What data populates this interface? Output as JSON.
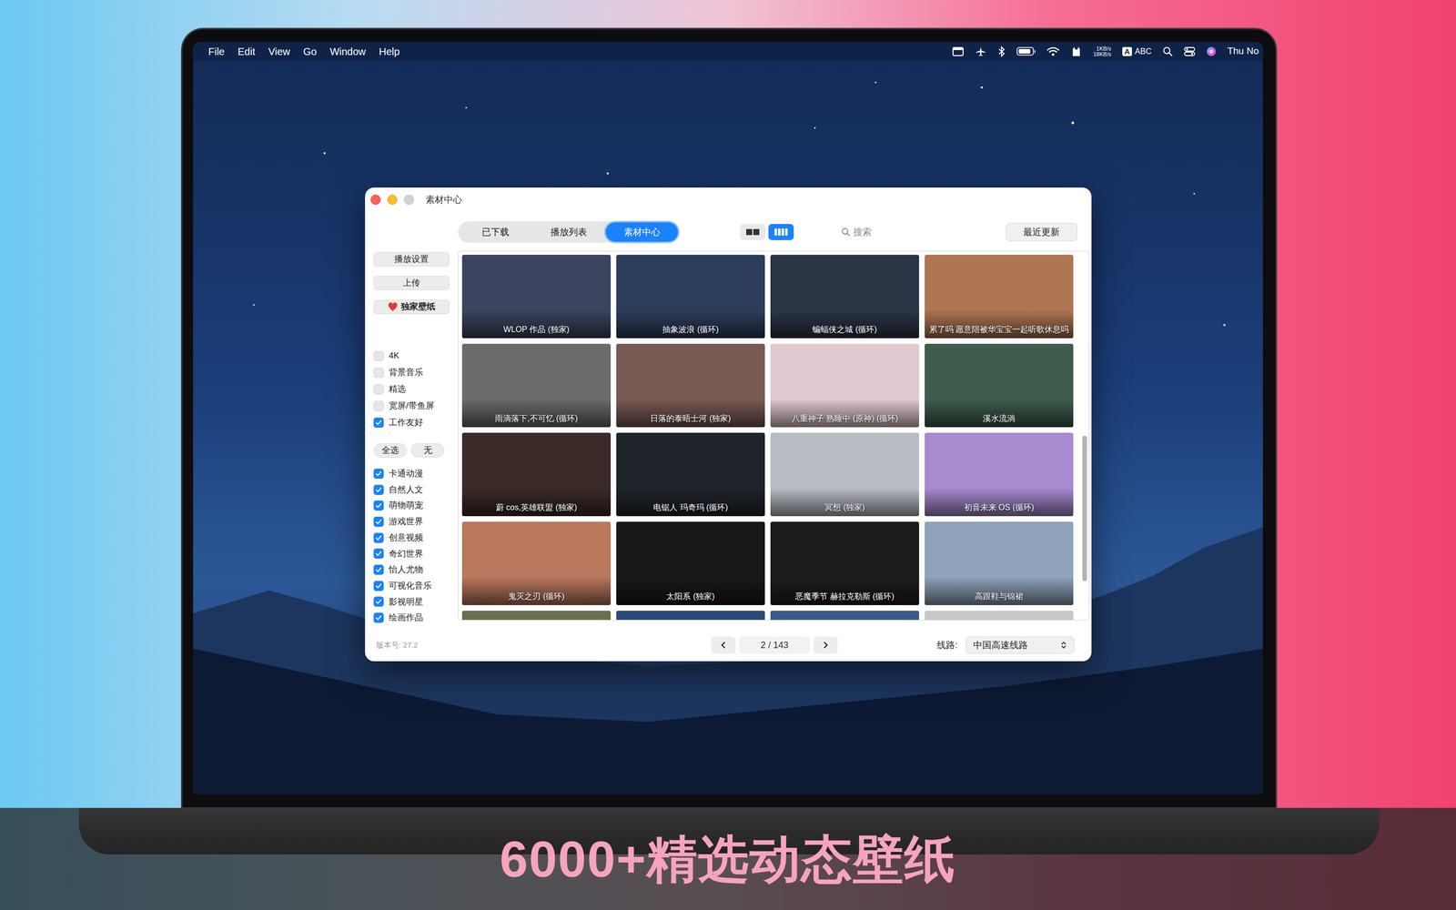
{
  "menubar": {
    "menus": [
      "File",
      "Edit",
      "View",
      "Go",
      "Window",
      "Help"
    ],
    "battery": {
      "level": 0.85
    },
    "net_speed": [
      "1KB/s",
      "18KB/s"
    ],
    "input_badge": "A",
    "input_source": "ABC",
    "clock": "Thu No"
  },
  "window": {
    "title": "素材中心"
  },
  "tabs": [
    {
      "label": "已下载",
      "selected": false
    },
    {
      "label": "播放列表",
      "selected": false
    },
    {
      "label": "素材中心",
      "selected": true
    }
  ],
  "view_modes": [
    {
      "kind": "two-column",
      "selected": false
    },
    {
      "kind": "four-column",
      "selected": true
    }
  ],
  "search": {
    "placeholder": "搜索"
  },
  "sort_button": "最近更新",
  "sidebar": {
    "buttons": [
      {
        "label": "播放设置",
        "kind": "plain"
      },
      {
        "label": "上传",
        "kind": "plain"
      },
      {
        "label": "独家壁纸",
        "kind": "featured"
      }
    ],
    "filters": [
      {
        "label": "4K",
        "checked": false
      },
      {
        "label": "背景音乐",
        "checked": false
      },
      {
        "label": "精选",
        "checked": false
      },
      {
        "label": "宽屏/带鱼屏",
        "checked": false
      },
      {
        "label": "工作友好",
        "checked": true
      }
    ],
    "select_buttons": [
      "全选",
      "无"
    ],
    "categories": [
      {
        "label": "卡通动漫",
        "checked": true
      },
      {
        "label": "自然人文",
        "checked": true
      },
      {
        "label": "萌物萌宠",
        "checked": true
      },
      {
        "label": "游戏世界",
        "checked": true
      },
      {
        "label": "创意视频",
        "checked": true
      },
      {
        "label": "奇幻世界",
        "checked": true
      },
      {
        "label": "怡人尤物",
        "checked": true
      },
      {
        "label": "可视化音乐",
        "checked": true
      },
      {
        "label": "影视明星",
        "checked": true
      },
      {
        "label": "绘画作品",
        "checked": true
      }
    ],
    "version": "版本号: 27.2"
  },
  "grid": {
    "items": [
      {
        "title": "WLOP 作品 (独家)",
        "color": "#3b4560"
      },
      {
        "title": "抽象波浪 (循环)",
        "color": "#2c3d5c"
      },
      {
        "title": "蝙蝠侠之城 (循环)",
        "color": "#2a3546"
      },
      {
        "title": "累了吗 愿意陪被华宝宝一起听歌休息吗",
        "color": "#b07552"
      },
      {
        "title": "雨滴落下,不可忆 (循环)",
        "color": "#6b6b6b"
      },
      {
        "title": "日落的泰晤士河 (独家)",
        "color": "#7a5a54"
      },
      {
        "title": "八重神子 熟睡中 (原神) (循环)",
        "color": "#e2c8d2"
      },
      {
        "title": "溪水流淌",
        "color": "#3e5c4c"
      },
      {
        "title": "蔚 cos,英雄联盟 (独家)",
        "color": "#3a2a28"
      },
      {
        "title": "电锯人 玛奇玛 (循环)",
        "color": "#1f242b"
      },
      {
        "title": "冥想 (独家)",
        "color": "#b8bcc4"
      },
      {
        "title": "初音未来 OS (循环)",
        "color": "#a78ad0"
      },
      {
        "title": "鬼灭之刃 (循环)",
        "color": "#b9785c"
      },
      {
        "title": "太阳系 (独家)",
        "color": "#181818"
      },
      {
        "title": "恶魔季节 赫拉克勒斯 (循环)",
        "color": "#1c1c1c"
      },
      {
        "title": "高跟鞋与锦裙",
        "color": "#8ea3ba"
      }
    ],
    "partial_items": [
      {
        "color": "#6a6f52"
      },
      {
        "color": "#2a4a7a"
      },
      {
        "color": "#3a5a8a"
      },
      {
        "color": "#c8c8c8"
      }
    ]
  },
  "scrollbar": {
    "position": 0.5,
    "level": 0.4
  },
  "pagination": {
    "page": "2 / 143"
  },
  "route": {
    "label": "线路:",
    "value": "中国高速线路"
  },
  "banner": {
    "text": "6000+精选动态壁纸"
  }
}
